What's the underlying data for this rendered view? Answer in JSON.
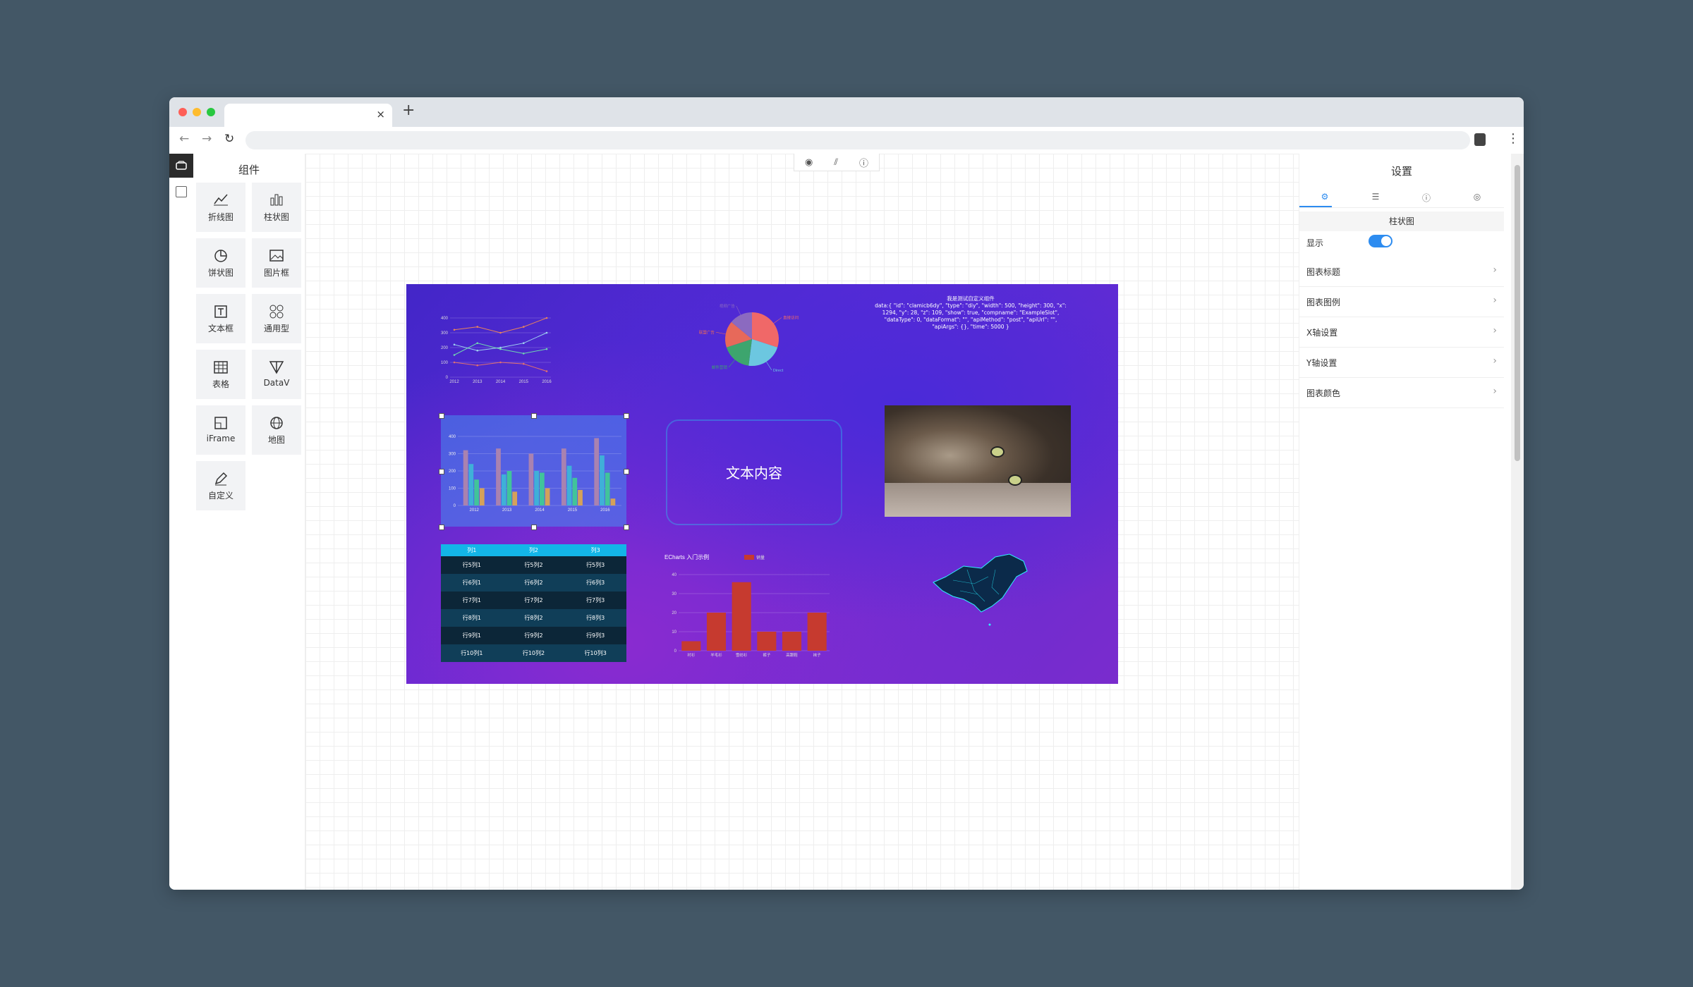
{
  "browser": {
    "tab_close": "×",
    "tab_new": "+",
    "back": "←",
    "forward": "→",
    "reload": "↻",
    "menu": "⋮"
  },
  "components": {
    "title": "组件",
    "items": [
      {
        "label": "折线图",
        "icon": "line-chart-icon"
      },
      {
        "label": "柱状图",
        "icon": "bar-chart-icon"
      },
      {
        "label": "饼状图",
        "icon": "pie-chart-icon"
      },
      {
        "label": "图片框",
        "icon": "image-icon"
      },
      {
        "label": "文本框",
        "icon": "text-icon"
      },
      {
        "label": "通用型",
        "icon": "grid-icon"
      },
      {
        "label": "表格",
        "icon": "table-icon"
      },
      {
        "label": "DataV",
        "icon": "datav-icon"
      },
      {
        "label": "iFrame",
        "icon": "iframe-icon"
      },
      {
        "label": "地图",
        "icon": "globe-icon"
      },
      {
        "label": "自定义",
        "icon": "pencil-icon"
      }
    ]
  },
  "toolbar": {
    "preview": "◉",
    "chart": "⫽",
    "info": "ⓘ"
  },
  "settings": {
    "title": "设置",
    "tabs": [
      "⚙",
      "☰",
      "ⓘ",
      "◎"
    ],
    "section": "柱状图",
    "show_label": "显示",
    "rows": [
      "图表标题",
      "图表图例",
      "X轴设置",
      "Y轴设置",
      "图表颜色"
    ]
  },
  "stage": {
    "text_widget": "文本内容",
    "custom_widget": {
      "title": "我是测试自定义组件",
      "data": "data:{ \"id\": \"clamicb6dy\", \"type\": \"diy\", \"width\": 500, \"height\": 300, \"x\": 1294, \"y\": 28, \"z\": 109, \"show\": true, \"compname\": \"ExampleSlot\", \"dataType\": 0, \"dataFormat\": \"\", \"apiMethod\": \"post\", \"apiUrl\": \"\", \"apiArgs\": {}, \"time\": 5000 }"
    },
    "table": {
      "headers": [
        "列1",
        "列2",
        "列3"
      ],
      "rows": [
        [
          "行5列1",
          "行5列2",
          "行5列3"
        ],
        [
          "行6列1",
          "行6列2",
          "行6列3"
        ],
        [
          "行7列1",
          "行7列2",
          "行7列3"
        ],
        [
          "行8列1",
          "行8列2",
          "行8列3"
        ],
        [
          "行9列1",
          "行9列2",
          "行9列3"
        ],
        [
          "行10列1",
          "行10列2",
          "行10列3"
        ]
      ]
    }
  },
  "chart_data": [
    {
      "type": "line",
      "x": [
        "2012",
        "2013",
        "2014",
        "2015",
        "2016"
      ],
      "ylim": [
        0,
        400
      ],
      "yticks": [
        0,
        100,
        200,
        300,
        400
      ],
      "series": [
        {
          "values": [
            320,
            340,
            300,
            340,
            400
          ],
          "color": "#e8845c"
        },
        {
          "values": [
            220,
            180,
            200,
            230,
            300
          ],
          "color": "#9fd1f0"
        },
        {
          "values": [
            150,
            230,
            190,
            160,
            190
          ],
          "color": "#6fd6b0"
        },
        {
          "values": [
            100,
            80,
            100,
            90,
            40
          ],
          "color": "#e07070"
        }
      ]
    },
    {
      "type": "bar",
      "x": [
        "2012",
        "2013",
        "2014",
        "2015",
        "2016"
      ],
      "ylim": [
        0,
        400
      ],
      "yticks": [
        0,
        100,
        200,
        300,
        400
      ],
      "series": [
        {
          "values": [
            320,
            330,
            300,
            330,
            390
          ],
          "color": "#a982b0"
        },
        {
          "values": [
            240,
            180,
            200,
            230,
            290
          ],
          "color": "#3fb0d8"
        },
        {
          "values": [
            150,
            200,
            190,
            160,
            190
          ],
          "color": "#41c49a"
        },
        {
          "values": [
            100,
            80,
            100,
            90,
            40
          ],
          "color": "#d4a15a"
        }
      ]
    },
    {
      "type": "pie",
      "values": [
        30,
        22,
        18,
        16,
        14
      ],
      "colors": [
        "#f06868",
        "#6cc7e0",
        "#3da56e",
        "#e7695a",
        "#8b6ac0"
      ],
      "labels": [
        "直接访问",
        "Direct",
        "邮件营销",
        "联盟广告",
        "视频广告"
      ]
    },
    {
      "type": "bar",
      "title": "ECharts 入门示例",
      "legend": "销量",
      "categories": [
        "衬衫",
        "羊毛衫",
        "雪纺衫",
        "裤子",
        "高跟鞋",
        "袜子"
      ],
      "values": [
        5,
        20,
        36,
        10,
        10,
        20
      ],
      "ylim": [
        0,
        40
      ],
      "yticks": [
        0,
        10,
        20,
        30,
        40
      ],
      "color": "#c63a2f"
    }
  ],
  "colors": {
    "accent": "#2d8cf0",
    "table_header": "#13b5e8"
  }
}
